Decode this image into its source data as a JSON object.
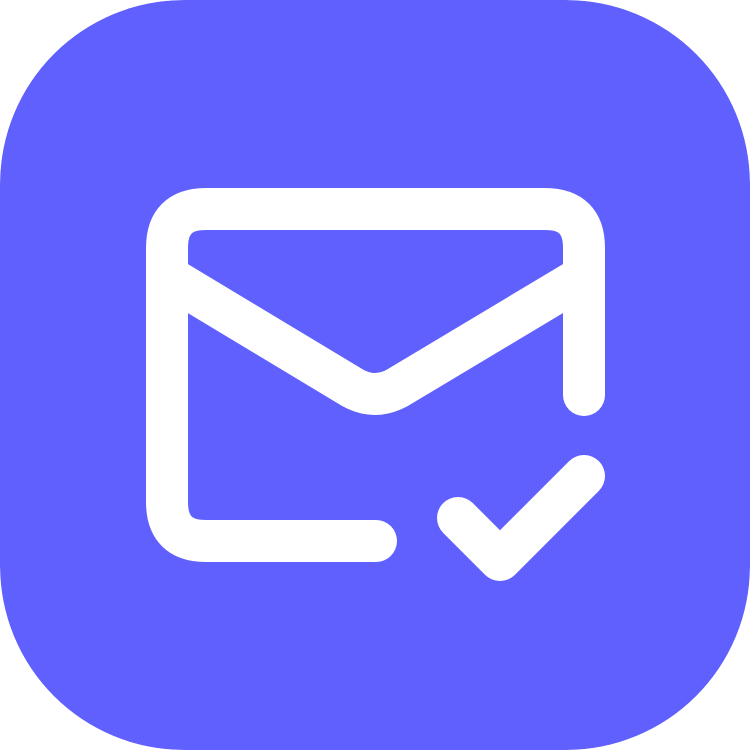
{
  "icon": {
    "name": "mail-check-icon",
    "background_color": "#6060ff",
    "glyph_color": "#ffffff"
  }
}
